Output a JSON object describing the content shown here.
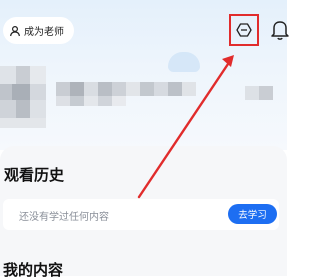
{
  "header": {
    "become_teacher_label": "成为老师",
    "icons": {
      "teacher": "user-icon",
      "switch": "switch-hexagon-icon",
      "notifications": "bell-icon"
    }
  },
  "history": {
    "title": "观看历史",
    "empty_text": "还没有学过任何内容",
    "action_label": "去学习"
  },
  "my_content": {
    "title": "我的内容"
  },
  "colors": {
    "accent": "#1d6ef2",
    "highlight": "#e12c2c"
  }
}
